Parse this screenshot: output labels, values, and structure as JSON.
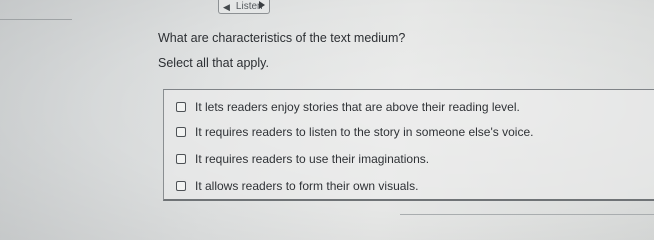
{
  "toolbar": {
    "listen_label": "Listen",
    "speaker_icon": "speaker-icon",
    "play_icon": "play-icon"
  },
  "question": {
    "prompt": "What are characteristics of the text medium?",
    "instruction": "Select all that apply."
  },
  "options": [
    {
      "label": "It lets readers enjoy stories that are above their reading level.",
      "checked": false
    },
    {
      "label": "It requires readers to listen to the story in someone else's voice.",
      "checked": false
    },
    {
      "label": "It requires readers to use their imaginations.",
      "checked": false
    },
    {
      "label": "It allows readers to form their own visuals.",
      "checked": false
    }
  ]
}
